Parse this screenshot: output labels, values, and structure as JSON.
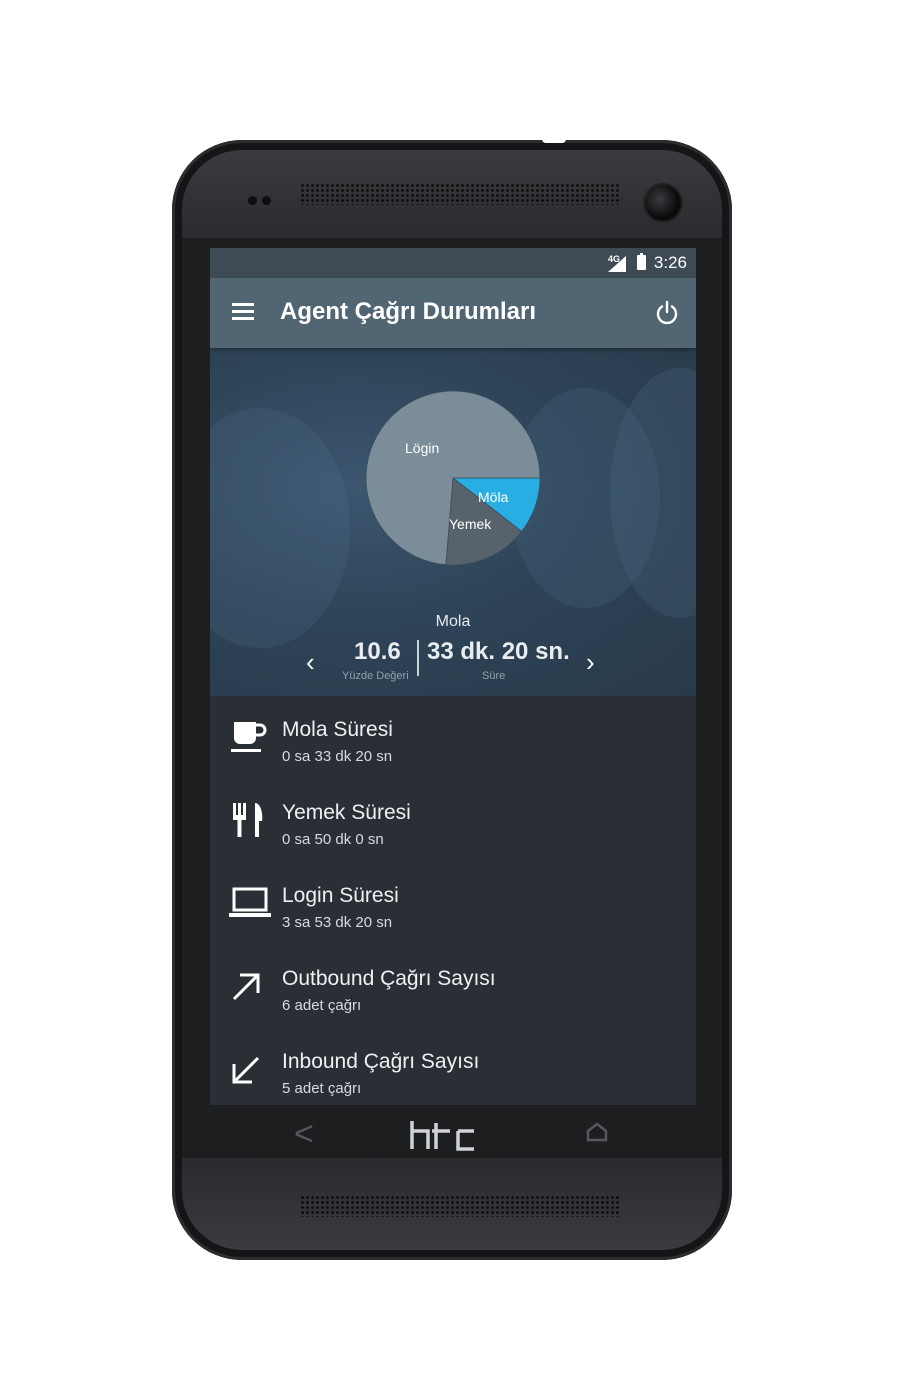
{
  "status_bar": {
    "network": "4G",
    "time": "3:26"
  },
  "app_bar": {
    "title": "Agent Çağrı Durumları"
  },
  "chart_data": {
    "type": "pie",
    "categories": [
      "Login",
      "Mola",
      "Yemek"
    ],
    "values": [
      233.3,
      33.3,
      50
    ],
    "colors": [
      "#7a8d99",
      "#29aee3",
      "#56636d"
    ],
    "labels": [
      "Lögin",
      "Möla",
      "Yemek"
    ]
  },
  "summary": {
    "caption": "Mola",
    "percent_value": "10.6",
    "percent_label": "Yüzde Değeri",
    "duration_value": "33 dk. 20 sn.",
    "duration_label": "Süre"
  },
  "list": [
    {
      "icon": "coffee-cup-icon",
      "title": "Mola Süresi",
      "subtitle": "0 sa 33 dk 20 sn"
    },
    {
      "icon": "fork-knife-icon",
      "title": "Yemek Süresi",
      "subtitle": "0 sa 50 dk 0 sn"
    },
    {
      "icon": "laptop-icon",
      "title": "Login Süresi",
      "subtitle": "3 sa 53 dk 20 sn"
    },
    {
      "icon": "arrow-outbound-icon",
      "title": "Outbound Çağrı Sayısı",
      "subtitle": "6 adet çağrı"
    },
    {
      "icon": "arrow-inbound-icon",
      "title": "Inbound Çağrı Sayısı",
      "subtitle": "5 adet çağrı"
    }
  ],
  "device": {
    "brand_logo": "htc"
  }
}
